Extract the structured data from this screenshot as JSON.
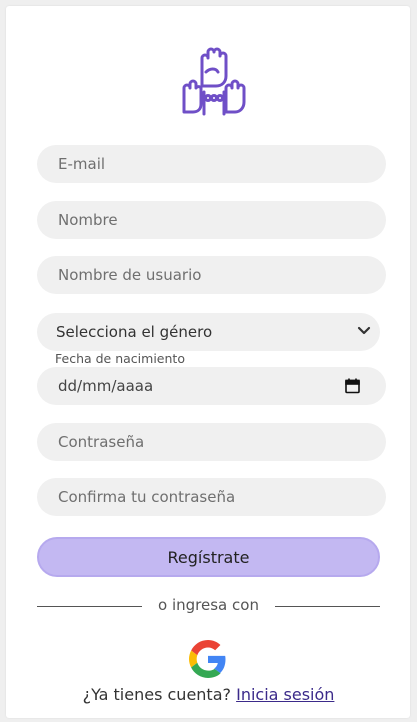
{
  "form": {
    "email_placeholder": "E-mail",
    "name_placeholder": "Nombre",
    "username_placeholder": "Nombre de usuario",
    "gender_selected": "Selecciona el género",
    "birthdate_label": "Fecha de nacimiento",
    "birthdate_placeholder": "dd/mm/aaaa",
    "password_placeholder": "Contraseña",
    "confirm_password_placeholder": "Confirma tu contraseña",
    "submit_label": "Regístrate"
  },
  "alt_login": {
    "divider_text": "o ingresa con",
    "google_icon": "google-logo"
  },
  "footer": {
    "question": "¿Ya tienes cuenta?",
    "login_link": "Inicia sesión"
  },
  "colors": {
    "accent": "#c3b8f2",
    "logo": "#6f4fc7",
    "field_bg": "#f0f0f0"
  }
}
